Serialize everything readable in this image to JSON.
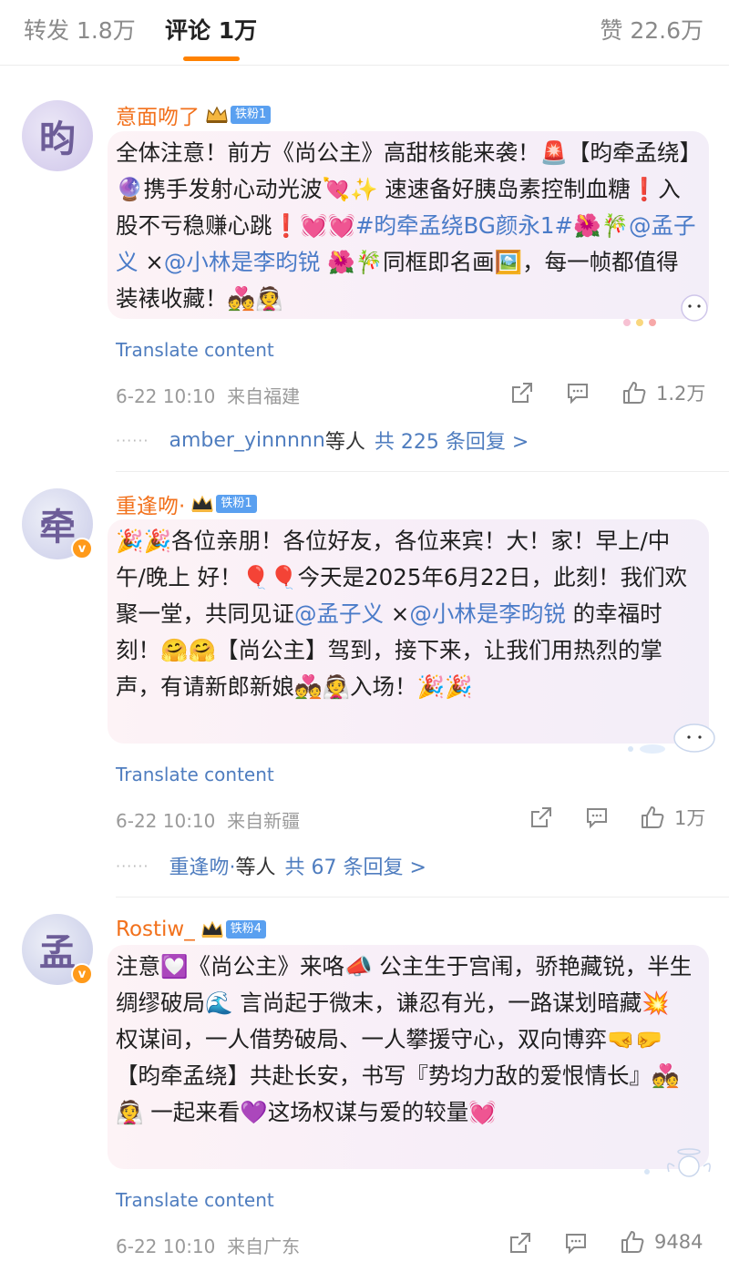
{
  "tabs": {
    "repost": "转发 1.8万",
    "comments": "评论 1万",
    "likes": "赞 22.6万"
  },
  "colors": {
    "accent": "#ff8200",
    "username": "#f2711c",
    "link": "#4f7dbf",
    "fan_badge": "#5aa0f0"
  },
  "comments": [
    {
      "avatar_char": "昀",
      "username": "意面吻了",
      "fan_label": "铁粉1",
      "text_parts": [
        "全体注意！前方《尚公主》高甜核能来袭！🚨【昀牵孟绕】🔮携手发射心动光波💘✨ 速速备好胰岛素控制血糖❗️入股不亏稳赚心跳❗️💓💓",
        "#昀牵孟绕BG颜永1#",
        "🌺🎋",
        "@孟子义",
        " ×",
        "@小林是李昀锐",
        " 🌺🎋同框即名画🖼️，每一帧都值得装裱收藏！💑👰"
      ],
      "translate": "Translate content",
      "time": "6-22 10:10",
      "location": "来自福建",
      "likes": "1.2万",
      "reply_user": "amber_yinnnnn",
      "reply_etc": "等人",
      "reply_count": "共 225 条回复 >"
    },
    {
      "avatar_char": "牵",
      "username": "重逢吻·",
      "fan_label": "铁粉1",
      "text_parts": [
        "🎉🎉各位亲朋！各位好友，各位来宾！大！家！早上/中午/晚上 好！🎈🎈今天是2025年6月22日，此刻！我们欢聚一堂，共同见证",
        "@孟子义",
        " ×",
        "@小林是李昀锐",
        " 的幸福时刻！🤗🤗【尚公主】驾到，接下来，让我们用热烈的掌声，有请新郎新娘💑👰入场！🎉🎉"
      ],
      "translate": "Translate content",
      "time": "6-22 10:10",
      "location": "来自新疆",
      "likes": "1万",
      "reply_user": "重逢吻·",
      "reply_etc": "等人",
      "reply_count": "共 67 条回复 >"
    },
    {
      "avatar_char": "孟",
      "username": "Rostiw_",
      "fan_label": "铁粉4",
      "text_parts": [
        "注意💟《尚公主》来咯📣 公主生于宫闱，骄艳藏锐，半生绸缪破局🌊 言尚起于微末，谦忍有光，一路谋划暗藏💥 权谋间，一人借势破局、一人攀援守心，双向博弈🤜🤛【昀牵孟绕】共赴长安，书写『势均力敌的爱恨情长』💑👰 一起来看💜这场权谋与爱的较量💓"
      ],
      "translate": "Translate content",
      "time": "6-22 10:10",
      "location": "来自广东",
      "likes": "9484"
    }
  ]
}
